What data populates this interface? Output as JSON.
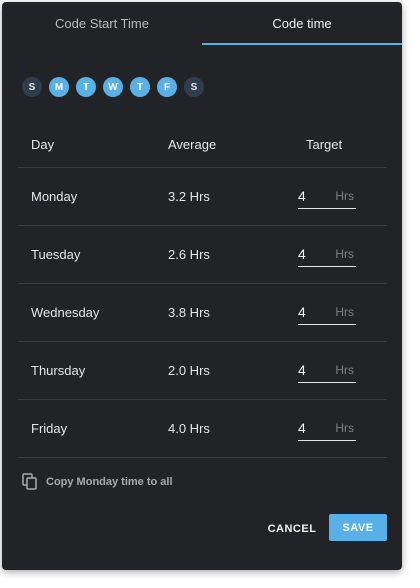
{
  "tabs": [
    {
      "label": "Code Start Time",
      "active": false
    },
    {
      "label": "Code time",
      "active": true
    }
  ],
  "day_selector": [
    {
      "letter": "S",
      "selected": false
    },
    {
      "letter": "M",
      "selected": true
    },
    {
      "letter": "T",
      "selected": true
    },
    {
      "letter": "W",
      "selected": true
    },
    {
      "letter": "T",
      "selected": true
    },
    {
      "letter": "F",
      "selected": true
    },
    {
      "letter": "S",
      "selected": false
    }
  ],
  "table": {
    "headers": {
      "day": "Day",
      "average": "Average",
      "target": "Target"
    },
    "rows": [
      {
        "day": "Monday",
        "average": "3.2 Hrs",
        "target": "4",
        "unit": "Hrs"
      },
      {
        "day": "Tuesday",
        "average": "2.6 Hrs",
        "target": "4",
        "unit": "Hrs"
      },
      {
        "day": "Wednesday",
        "average": "3.8 Hrs",
        "target": "4",
        "unit": "Hrs"
      },
      {
        "day": "Thursday",
        "average": "2.0 Hrs",
        "target": "4",
        "unit": "Hrs"
      },
      {
        "day": "Friday",
        "average": "4.0 Hrs",
        "target": "4",
        "unit": "Hrs"
      }
    ]
  },
  "copy_action": {
    "label": "Copy Monday time to all",
    "icon": "copy-icon"
  },
  "actions": {
    "cancel": "CANCEL",
    "save": "SAVE"
  },
  "colors": {
    "accent": "#58b0e6",
    "background": "#222327",
    "unselected_day": "#2f3e4e"
  }
}
